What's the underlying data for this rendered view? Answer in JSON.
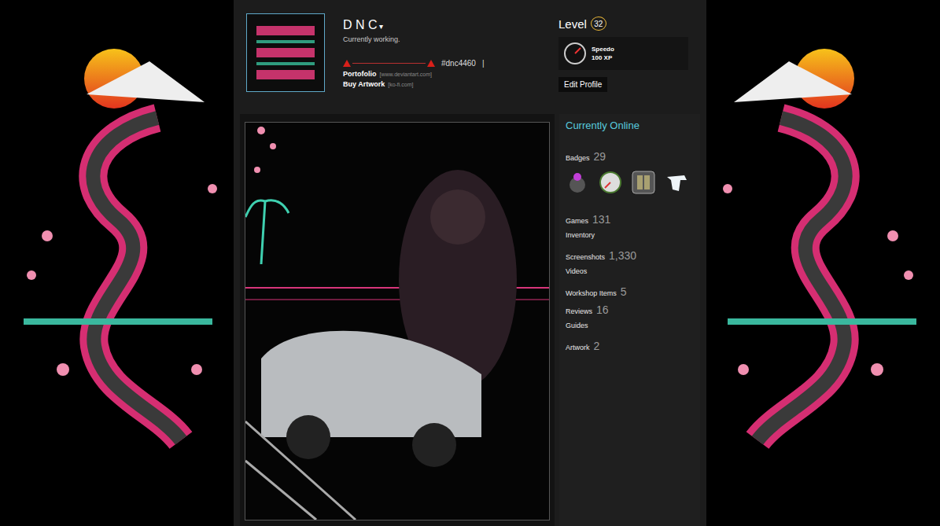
{
  "profile": {
    "name": "D N C",
    "dropdown": "▾",
    "status": "Currently working.",
    "tag": "#dnc4460",
    "separator": "|",
    "links": [
      {
        "label": "Portofolio",
        "url": "[www.deviantart.com]"
      },
      {
        "label": "Buy Artwork",
        "url": "[ko-fi.com]"
      }
    ]
  },
  "level": {
    "label": "Level",
    "value": "32"
  },
  "featured_badge": {
    "name": "Speedo",
    "xp": "100 XP"
  },
  "edit_button": "Edit Profile",
  "online_status": "Currently Online",
  "badges": {
    "label": "Badges",
    "count": "29"
  },
  "stats": [
    {
      "label": "Games",
      "count": "131"
    },
    {
      "label": "Inventory"
    },
    {
      "label": "Screenshots",
      "count": "1,330"
    },
    {
      "label": "Videos"
    },
    {
      "label": "Workshop Items",
      "count": "5"
    },
    {
      "label": "Reviews",
      "count": "16"
    },
    {
      "label": "Guides"
    },
    {
      "label": "Artwork",
      "count": "2"
    }
  ]
}
